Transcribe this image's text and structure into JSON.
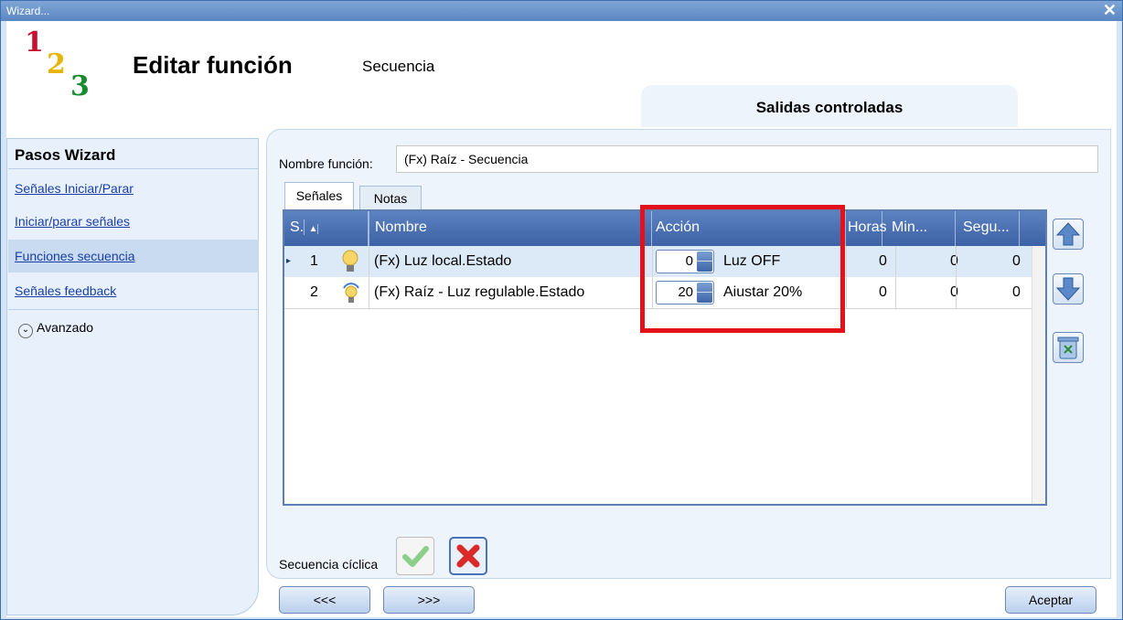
{
  "window": {
    "title": "Wizard...",
    "close_glyph": "✕"
  },
  "logo": {
    "d1": "1",
    "d2": "2",
    "d3": "3",
    "colors": [
      "#c8102e",
      "#e8b400",
      "#1a8a2e"
    ]
  },
  "header": {
    "title": "Editar función",
    "subtitle": "Secuencia",
    "outputs_tab": "Salidas controladas"
  },
  "sidebar": {
    "heading": "Pasos Wizard",
    "items": [
      {
        "label": "Señales Iniciar/Parar",
        "active": false
      },
      {
        "label": "Iniciar/parar señales",
        "active": false
      },
      {
        "label": "Funciones secuencia",
        "active": true
      },
      {
        "label": "Señales feedback",
        "active": false
      }
    ],
    "advanced": {
      "label": "Avanzado",
      "icon": "chevron-down-icon"
    }
  },
  "form": {
    "name_label": "Nombre función:",
    "name_value": "(Fx) Raíz - Secuencia"
  },
  "tabs": [
    {
      "label": "Señales",
      "selected": true
    },
    {
      "label": "Notas",
      "selected": false
    }
  ],
  "table": {
    "columns": [
      "S.",
      "Nombre",
      "Acción",
      "Horas",
      "Min...",
      "Segu..."
    ],
    "sort_glyph": "▲",
    "rows": [
      {
        "step": "1",
        "name": "(Fx) Luz local.Estado",
        "action_value": "0",
        "action_label": "Luz OFF",
        "hours": "0",
        "minutes": "0",
        "seconds": "0",
        "icon": "light-bulb-icon"
      },
      {
        "step": "2",
        "name": "(Fx) Raíz - Luz regulable.Estado",
        "action_value": "20",
        "action_label": "Aiustar 20%",
        "hours": "0",
        "minutes": "0",
        "seconds": "0",
        "icon": "dimmable-bulb-icon"
      }
    ]
  },
  "highlight_color": "#e3111b",
  "cyclic": {
    "label": "Secuencia cíclica"
  },
  "footer": {
    "prev": "<<<",
    "next": ">>>",
    "accept": "Aceptar"
  }
}
